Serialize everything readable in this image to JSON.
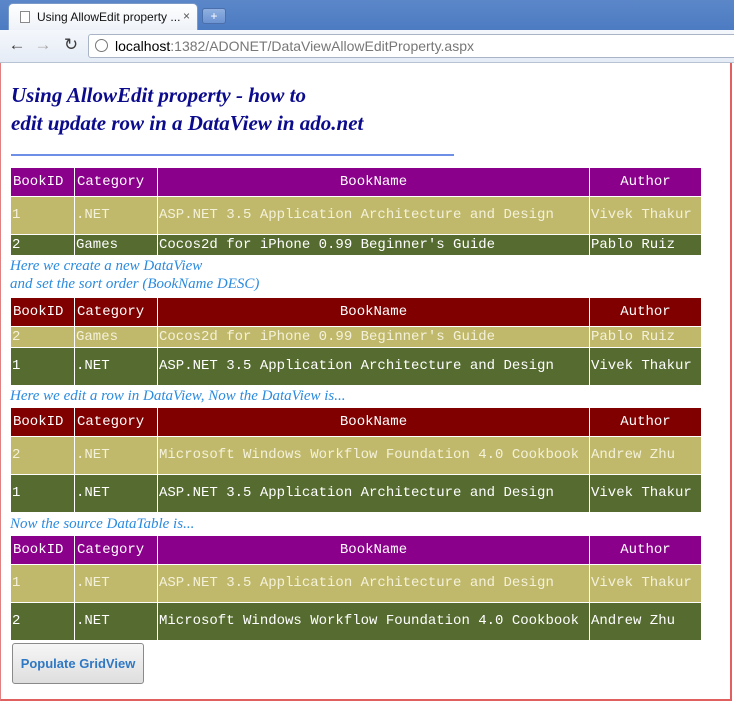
{
  "browser": {
    "tab_title": "Using AllowEdit property ...",
    "tab_close": "×",
    "new_tab": "+",
    "url_host": "localhost",
    "url_rest": ":1382/ADONET/DataViewAllowEditProperty.aspx"
  },
  "page": {
    "heading_line1": "Using AllowEdit property - how to",
    "heading_line2": "edit update row in a DataView in ado.net",
    "caption1_line1": "Here we create a new DataView",
    "caption1_line2": "and set the sort order (BookName DESC)",
    "caption2": "Here we edit a row in DataView, Now the DataView is...",
    "caption3": "Now the source DataTable is...",
    "button_label": "Populate GridView"
  },
  "colors": {
    "header_purple": "#8b008b",
    "header_maroon": "#800000",
    "row_light": "#c0b96c",
    "row_dark": "#556b2f"
  },
  "columns": [
    "BookID",
    "Category",
    "BookName",
    "Author"
  ],
  "grid1": [
    {
      "id": "1",
      "category": ".NET",
      "name": "ASP.NET 3.5 Application Architecture and Design",
      "author": "Vivek Thakur"
    },
    {
      "id": "2",
      "category": "Games",
      "name": "Cocos2d for iPhone 0.99 Beginner's Guide",
      "author": "Pablo Ruiz"
    }
  ],
  "grid2": [
    {
      "id": "2",
      "category": "Games",
      "name": "Cocos2d for iPhone 0.99 Beginner's Guide",
      "author": "Pablo Ruiz"
    },
    {
      "id": "1",
      "category": ".NET",
      "name": "ASP.NET 3.5 Application Architecture and Design",
      "author": "Vivek Thakur"
    }
  ],
  "grid3": [
    {
      "id": "2",
      "category": ".NET",
      "name": "Microsoft Windows Workflow Foundation 4.0 Cookbook",
      "author": "Andrew Zhu"
    },
    {
      "id": "1",
      "category": ".NET",
      "name": "ASP.NET 3.5 Application Architecture and Design",
      "author": "Vivek Thakur"
    }
  ],
  "grid4": [
    {
      "id": "1",
      "category": ".NET",
      "name": "ASP.NET 3.5 Application Architecture and Design",
      "author": "Vivek Thakur"
    },
    {
      "id": "2",
      "category": ".NET",
      "name": "Microsoft Windows Workflow Foundation 4.0 Cookbook",
      "author": "Andrew Zhu"
    }
  ]
}
